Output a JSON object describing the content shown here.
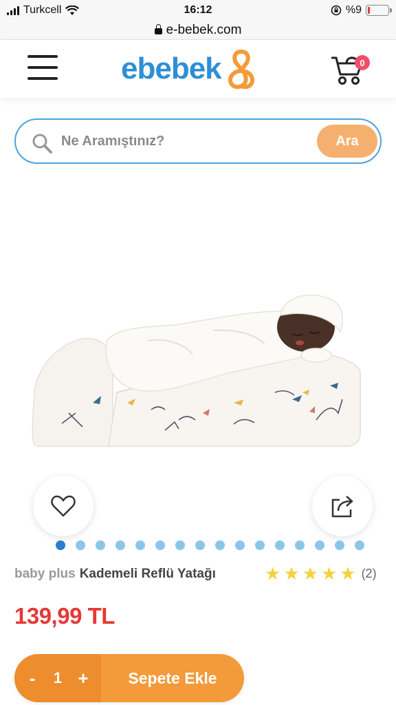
{
  "status_bar": {
    "carrier": "Turkcell",
    "time": "16:12",
    "battery": "%9",
    "battery_level": 0.09,
    "url": "e-bebek.com"
  },
  "header": {
    "logo_text": "ebebek",
    "cart_count": "0",
    "brand_color": "#2d8fd5",
    "accent_color": "#f39b3a"
  },
  "search": {
    "placeholder": "Ne Aramıştınız?",
    "button_label": "Ara"
  },
  "product": {
    "brand": "baby plus",
    "name": "Kademeli Reflü Yatağı",
    "rating": 5,
    "rating_count": "(2)",
    "price": "139,99 TL",
    "gallery_count": 16,
    "gallery_active_index": 0
  },
  "cart": {
    "decrement": "-",
    "quantity": "1",
    "increment": "+",
    "add_label": "Sepete Ekle"
  },
  "icons": {
    "menu": "hamburger-icon",
    "cart": "stroller-cart-icon",
    "search": "search-icon",
    "favorite": "heart-icon",
    "share": "share-icon"
  }
}
